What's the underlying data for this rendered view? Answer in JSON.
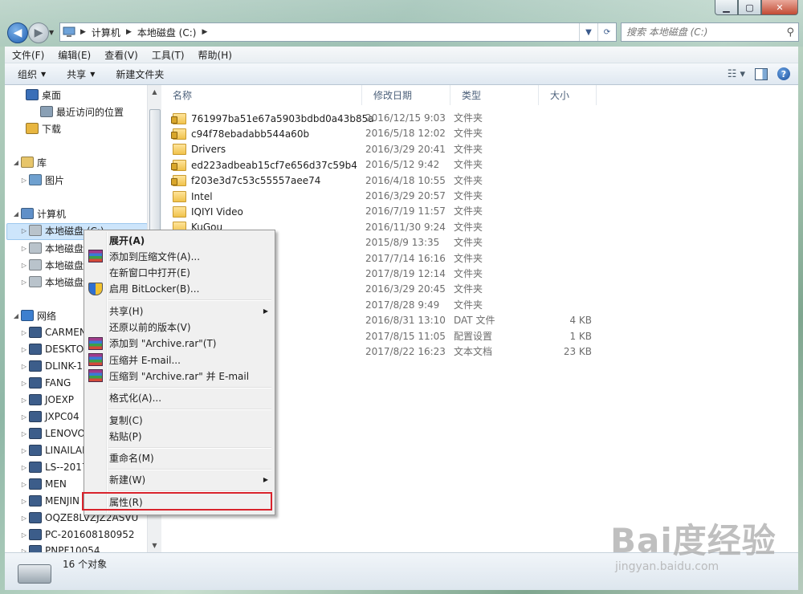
{
  "window": {
    "controls": {
      "minimize": "▁",
      "maximize": "▢",
      "close": "✕"
    }
  },
  "address": {
    "crumbs": [
      "计算机",
      "本地磁盘 (C:)"
    ],
    "search_placeholder": "搜索 本地磁盘 (C:)"
  },
  "menubar": [
    "文件(F)",
    "编辑(E)",
    "查看(V)",
    "工具(T)",
    "帮助(H)"
  ],
  "toolbar": {
    "organize": "组织",
    "share": "共享",
    "new_folder": "新建文件夹"
  },
  "navpane": {
    "items": [
      {
        "label": "桌面",
        "icon": "desktop-icon"
      },
      {
        "label": "最近访问的位置",
        "icon": "recent-places-icon"
      },
      {
        "label": "下载",
        "icon": "downloads-icon"
      },
      {
        "label": "库",
        "icon": "library-icon"
      },
      {
        "label": "图片",
        "icon": "pictures-icon"
      },
      {
        "label": "计算机",
        "icon": "computer-icon"
      },
      {
        "label": "本地磁盘 (C:)",
        "icon": "drive-icon"
      },
      {
        "label": "本地磁盘 (",
        "icon": "drive-icon"
      },
      {
        "label": "本地磁盘 (",
        "icon": "drive-icon"
      },
      {
        "label": "本地磁盘 (",
        "icon": "drive-icon"
      },
      {
        "label": "网络",
        "icon": "network-icon"
      },
      {
        "label": "CARMEN",
        "icon": "network-pc-icon"
      },
      {
        "label": "DESKTOP",
        "icon": "network-pc-icon"
      },
      {
        "label": "DLINK-13",
        "icon": "network-pc-icon"
      },
      {
        "label": "FANG",
        "icon": "network-pc-icon"
      },
      {
        "label": "JOEXP",
        "icon": "network-pc-icon"
      },
      {
        "label": "JXPC04",
        "icon": "network-pc-icon"
      },
      {
        "label": "LENOVO-",
        "icon": "network-pc-icon"
      },
      {
        "label": "LINAILAN",
        "icon": "network-pc-icon"
      },
      {
        "label": "LS--20170",
        "icon": "network-pc-icon"
      },
      {
        "label": "MEN",
        "icon": "network-pc-icon"
      },
      {
        "label": "MENJIN",
        "icon": "network-pc-icon"
      },
      {
        "label": "OQZE8LVZJZ2ASVU",
        "icon": "network-pc-icon"
      },
      {
        "label": "PC-201608180952",
        "icon": "network-pc-icon"
      },
      {
        "label": "PNPF10054",
        "icon": "network-pc-icon"
      }
    ]
  },
  "columns": {
    "name": "名称",
    "date": "修改日期",
    "type": "类型",
    "size": "大小"
  },
  "files": [
    {
      "name": "761997ba51e67a5903bdbd0a43b85a",
      "date": "2016/12/15 9:03",
      "type": "文件夹",
      "size": "",
      "locked": true
    },
    {
      "name": "c94f78ebadabb544a60b",
      "date": "2016/5/18 12:02",
      "type": "文件夹",
      "size": "",
      "locked": true
    },
    {
      "name": "Drivers",
      "date": "2016/3/29 20:41",
      "type": "文件夹",
      "size": "",
      "locked": false
    },
    {
      "name": "ed223adbeab15cf7e656d37c59b4",
      "date": "2016/5/12 9:42",
      "type": "文件夹",
      "size": "",
      "locked": true
    },
    {
      "name": "f203e3d7c53c55557aee74",
      "date": "2016/4/18 10:55",
      "type": "文件夹",
      "size": "",
      "locked": true
    },
    {
      "name": "Intel",
      "date": "2016/3/29 20:57",
      "type": "文件夹",
      "size": "",
      "locked": false
    },
    {
      "name": "IQIYI Video",
      "date": "2016/7/19 11:57",
      "type": "文件夹",
      "size": "",
      "locked": false
    },
    {
      "name": "KuGou",
      "date": "2016/11/30 9:24",
      "type": "文件夹",
      "size": "",
      "locked": false
    },
    {
      "name": "",
      "date": "2015/8/9 13:35",
      "type": "文件夹",
      "size": "",
      "locked": false
    },
    {
      "name": "",
      "date": "2017/7/14 16:16",
      "type": "文件夹",
      "size": "",
      "locked": false
    },
    {
      "name": "",
      "date": "2017/8/19 12:14",
      "type": "文件夹",
      "size": "",
      "locked": false
    },
    {
      "name": "",
      "date": "2016/3/29 20:45",
      "type": "文件夹",
      "size": "",
      "locked": false
    },
    {
      "name": "",
      "date": "2017/8/28 9:49",
      "type": "文件夹",
      "size": "",
      "locked": false
    },
    {
      "name": "",
      "date": "2016/8/31 13:10",
      "type": "DAT 文件",
      "size": "4 KB",
      "locked": false
    },
    {
      "name": "",
      "date": "2017/8/15 11:05",
      "type": "配置设置",
      "size": "1 KB",
      "locked": false
    },
    {
      "name": "",
      "date": "2017/8/22 16:23",
      "type": "文本文档",
      "size": "23 KB",
      "locked": false
    }
  ],
  "context_menu": [
    {
      "label": "展开(A)",
      "bold": true,
      "icon": ""
    },
    {
      "label": "添加到压缩文件(A)...",
      "icon": "winrar-icon"
    },
    {
      "label": "在新窗口中打开(E)",
      "icon": ""
    },
    {
      "label": "启用 BitLocker(B)...",
      "icon": "shield-icon"
    },
    {
      "sep": true
    },
    {
      "label": "共享(H)",
      "icon": "",
      "submenu": true
    },
    {
      "label": "还原以前的版本(V)",
      "icon": ""
    },
    {
      "label": "添加到 \"Archive.rar\"(T)",
      "icon": "winrar-icon"
    },
    {
      "label": "压缩并 E-mail...",
      "icon": "winrar-icon"
    },
    {
      "label": "压缩到 \"Archive.rar\" 并 E-mail",
      "icon": "winrar-icon"
    },
    {
      "sep": true
    },
    {
      "label": "格式化(A)...",
      "icon": ""
    },
    {
      "sep": true
    },
    {
      "label": "复制(C)",
      "icon": ""
    },
    {
      "label": "粘贴(P)",
      "icon": ""
    },
    {
      "sep": true
    },
    {
      "label": "重命名(M)",
      "icon": ""
    },
    {
      "sep": true
    },
    {
      "label": "新建(W)",
      "icon": "",
      "submenu": true
    },
    {
      "sep": true
    },
    {
      "label": "属性(R)",
      "icon": "",
      "highlighted": true
    }
  ],
  "status": {
    "count": "16 个对象"
  },
  "watermark": {
    "big": "Bai度经验",
    "small": "jingyan.baidu.com"
  }
}
